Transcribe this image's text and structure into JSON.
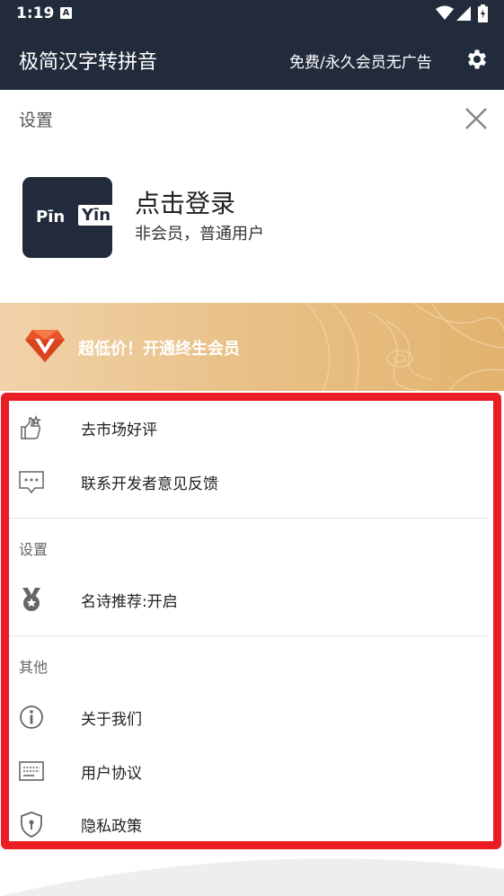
{
  "status": {
    "time": "1:19",
    "notification_letter": "A"
  },
  "app": {
    "title": "极简汉字转拼音",
    "promo": "免费/永久会员无广告"
  },
  "panel": {
    "title": "设置"
  },
  "logo": {
    "pin": "Pīn",
    "yin": "Yīn"
  },
  "login": {
    "title": "点击登录",
    "subtitle": "非会员，普通用户"
  },
  "vip": {
    "text": "超低价！开通终生会员"
  },
  "menu": {
    "group1": [
      {
        "label": "去市场好评",
        "icon": "thumbs-up-icon"
      },
      {
        "label": "联系开发者意见反馈",
        "icon": "message-icon"
      }
    ],
    "section_settings": "设置",
    "group2": [
      {
        "label": "名诗推荐:开启",
        "icon": "medal-icon"
      }
    ],
    "section_other": "其他",
    "group3": [
      {
        "label": "关于我们",
        "icon": "info-icon"
      },
      {
        "label": "用户协议",
        "icon": "agreement-icon"
      },
      {
        "label": "隐私政策",
        "icon": "shield-icon"
      }
    ]
  },
  "colors": {
    "header": "#222b3b",
    "accent_highlight": "#ea1c24",
    "vip_gold": "#e2b36e",
    "vip_orange": "#e8532a"
  }
}
